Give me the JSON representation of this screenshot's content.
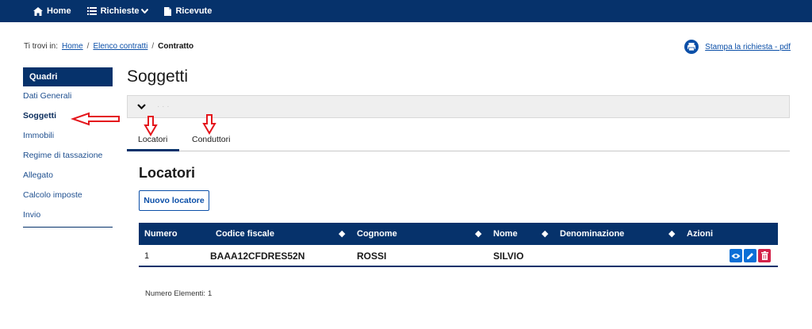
{
  "nav": {
    "home": "Home",
    "requests": "Richieste",
    "received": "Ricevute"
  },
  "breadcrumb": {
    "prefix": "Ti trovi in:",
    "items": [
      "Home",
      "Elenco contratti"
    ],
    "current": "Contratto"
  },
  "print_link": "Stampa la richiesta - pdf",
  "sidebar": {
    "header": "Quadri",
    "items": [
      {
        "label": "Dati Generali"
      },
      {
        "label": "Soggetti",
        "active": true
      },
      {
        "label": "Immobili"
      },
      {
        "label": "Regime di tassazione"
      },
      {
        "label": "Allegato"
      },
      {
        "label": "Calcolo imposte"
      },
      {
        "label": "Invio"
      }
    ]
  },
  "main": {
    "title": "Soggetti",
    "accordion_label": "· · ·",
    "tabs": [
      {
        "label": "Locatori",
        "active": true
      },
      {
        "label": "Conduttori"
      }
    ],
    "section_title": "Locatori",
    "new_button": "Nuovo locatore",
    "table": {
      "headers": [
        "Numero",
        "Codice fiscale",
        "Cognome",
        "Nome",
        "Denominazione",
        "Azioni"
      ],
      "rows": [
        {
          "numero": "1",
          "codice_fiscale": "BAAA12CFDRES52N",
          "cognome": "ROSSI",
          "nome": "SILVIO",
          "denominazione": ""
        }
      ]
    },
    "count_label": "Numero Elementi:",
    "count_value": "1"
  },
  "colors": {
    "primary": "#06326b",
    "link": "#0b4fa8",
    "action_blue": "#0b6fd6",
    "action_red": "#d4234a",
    "annotation": "#e4161c"
  },
  "icons": [
    "home-icon",
    "list-icon",
    "chevron-down-icon",
    "document-icon",
    "print-icon",
    "eye-icon",
    "pencil-icon",
    "trash-icon",
    "sort-icon"
  ]
}
